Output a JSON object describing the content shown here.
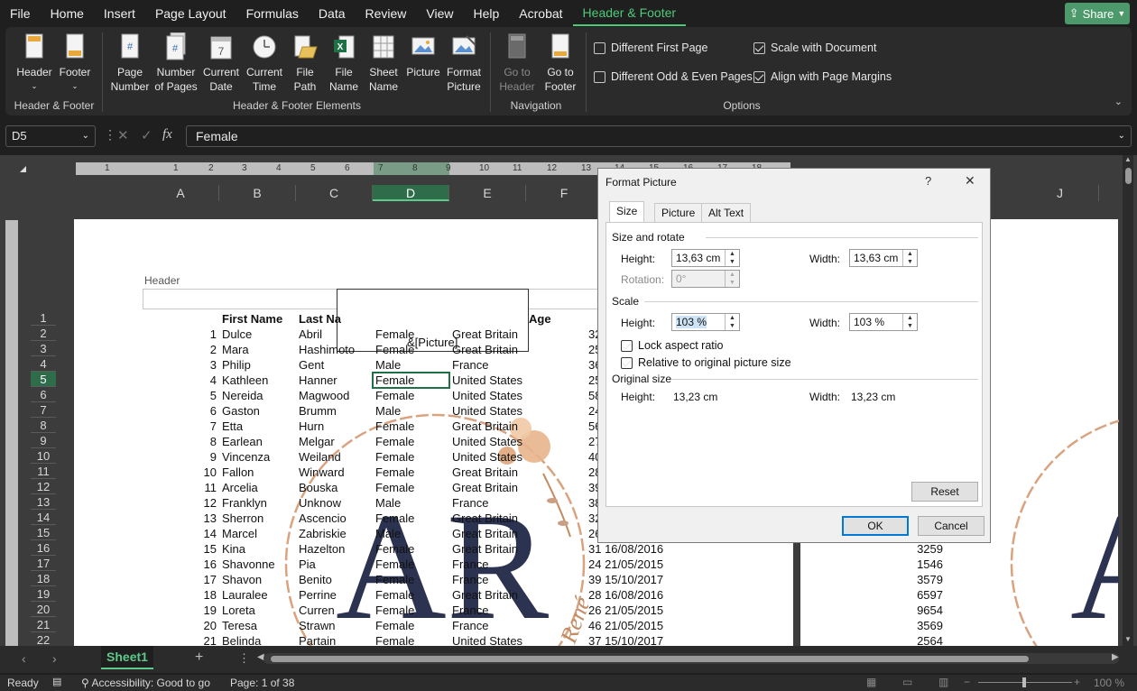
{
  "menu": {
    "items": [
      "File",
      "Home",
      "Insert",
      "Page Layout",
      "Formulas",
      "Data",
      "Review",
      "View",
      "Help",
      "Acrobat",
      "Header & Footer"
    ],
    "share": "Share"
  },
  "ribbon": {
    "header": "Header",
    "footer": "Footer",
    "group_hf": "Header & Footer",
    "page_number": [
      "Page",
      "Number"
    ],
    "number_of_pages": [
      "Number",
      "of Pages"
    ],
    "current_date": [
      "Current",
      "Date"
    ],
    "current_time": [
      "Current",
      "Time"
    ],
    "file_path": [
      "File",
      "Path"
    ],
    "file_name": [
      "File",
      "Name"
    ],
    "sheet_name": [
      "Sheet",
      "Name"
    ],
    "picture": "Picture",
    "format_picture": [
      "Format",
      "Picture"
    ],
    "group_elements": "Header & Footer Elements",
    "go_to_header": [
      "Go to",
      "Header"
    ],
    "go_to_footer": [
      "Go to",
      "Footer"
    ],
    "group_nav": "Navigation",
    "opt_diff_first": "Different First Page",
    "opt_diff_odd": "Different Odd & Even Pages",
    "opt_scale": "Scale with Document",
    "opt_align": "Align with Page Margins",
    "group_options": "Options"
  },
  "formula_bar": {
    "name_box": "D5",
    "fx": "fx",
    "value": "Female"
  },
  "ruler_nums": [
    "1",
    "1",
    "2",
    "3",
    "4",
    "5",
    "6",
    "7",
    "8",
    "9",
    "10",
    "11",
    "12",
    "13",
    "14",
    "15",
    "16",
    "17",
    "18"
  ],
  "columns": [
    "A",
    "B",
    "C",
    "D",
    "E",
    "F",
    "J"
  ],
  "sheet": {
    "header_label": "Header",
    "picture_code": "&[Picture]",
    "headers": [
      "First Name",
      "Last Na",
      "",
      "",
      "Age"
    ],
    "rows": [
      [
        "1",
        "Dulce",
        "Abril",
        "Female",
        "Great Britain",
        "32"
      ],
      [
        "2",
        "Mara",
        "Hashimoto",
        "Female",
        "Great Britain",
        "25"
      ],
      [
        "3",
        "Philip",
        "Gent",
        "Male",
        "France",
        "36"
      ],
      [
        "4",
        "Kathleen",
        "Hanner",
        "Female",
        "United States",
        "25"
      ],
      [
        "5",
        "Nereida",
        "Magwood",
        "Female",
        "United States",
        "58"
      ],
      [
        "6",
        "Gaston",
        "Brumm",
        "Male",
        "United States",
        "24"
      ],
      [
        "7",
        "Etta",
        "Hurn",
        "Female",
        "Great Britain",
        "56"
      ],
      [
        "8",
        "Earlean",
        "Melgar",
        "Female",
        "United States",
        "27"
      ],
      [
        "9",
        "Vincenza",
        "Weiland",
        "Female",
        "United States",
        "40"
      ],
      [
        "10",
        "Fallon",
        "Winward",
        "Female",
        "Great Britain",
        "28"
      ],
      [
        "11",
        "Arcelia",
        "Bouska",
        "Female",
        "Great Britain",
        "39"
      ],
      [
        "12",
        "Franklyn",
        "Unknow",
        "Male",
        "France",
        "38"
      ],
      [
        "13",
        "Sherron",
        "Ascencio",
        "Female",
        "Great Britain",
        "32"
      ],
      [
        "14",
        "Marcel",
        "Zabriskie",
        "Male",
        "Great Britain",
        "26"
      ],
      [
        "15",
        "Kina",
        "Hazelton",
        "Female",
        "Great Britain",
        "31 16/08/2016"
      ],
      [
        "16",
        "Shavonne",
        "Pia",
        "Female",
        "France",
        "24 21/05/2015"
      ],
      [
        "17",
        "Shavon",
        "Benito",
        "Female",
        "France",
        "39 15/10/2017"
      ],
      [
        "18",
        "Lauralee",
        "Perrine",
        "Female",
        "Great Britain",
        "28 16/08/2016"
      ],
      [
        "19",
        "Loreta",
        "Curren",
        "Female",
        "France",
        "26 21/05/2015"
      ],
      [
        "20",
        "Teresa",
        "Strawn",
        "Female",
        "France",
        "46 21/05/2015"
      ],
      [
        "21",
        "Belinda",
        "Partain",
        "Female",
        "United States",
        "37 15/10/2017"
      ]
    ],
    "right_values": [
      "3259",
      "1546",
      "3579",
      "6597",
      "9654",
      "3569",
      "2564"
    ],
    "row_numbers": [
      "1",
      "2",
      "3",
      "4",
      "5",
      "6",
      "7",
      "8",
      "9",
      "10",
      "11",
      "12",
      "13",
      "14",
      "15",
      "16",
      "17",
      "18",
      "19",
      "20",
      "21",
      "22"
    ],
    "watermark_letters": "AR",
    "watermark_script": "René"
  },
  "dialog": {
    "title": "Format Picture",
    "help": "?",
    "close": "✕",
    "tabs": [
      "Size",
      "Picture",
      "Alt Text"
    ],
    "size_rotate": "Size and rotate",
    "height_label": "Height:",
    "height_value": "13,63 cm",
    "width_label": "Width:",
    "width_value": "13,63 cm",
    "rotation_label": "Rotation:",
    "rotation_value": "0°",
    "scale": "Scale",
    "scale_height_value": "103 %",
    "scale_width_value": "103 %",
    "lock_aspect": "Lock aspect ratio",
    "relative": "Relative to original picture size",
    "original_size": "Original size",
    "orig_height": "13,23 cm",
    "orig_width": "13,23 cm",
    "reset": "Reset",
    "ok": "OK",
    "cancel": "Cancel"
  },
  "bottom": {
    "sheet_tab": "Sheet1",
    "status_ready": "Ready",
    "accessibility": "Accessibility: Good to go",
    "page_info": "Page: 1 of 38",
    "zoom": "100 %"
  },
  "colors": {
    "accent": "#4ec97a",
    "dialog_blue": "#0078d4",
    "watermark_navy": "#2c3350",
    "watermark_peach": "#d9a380"
  }
}
